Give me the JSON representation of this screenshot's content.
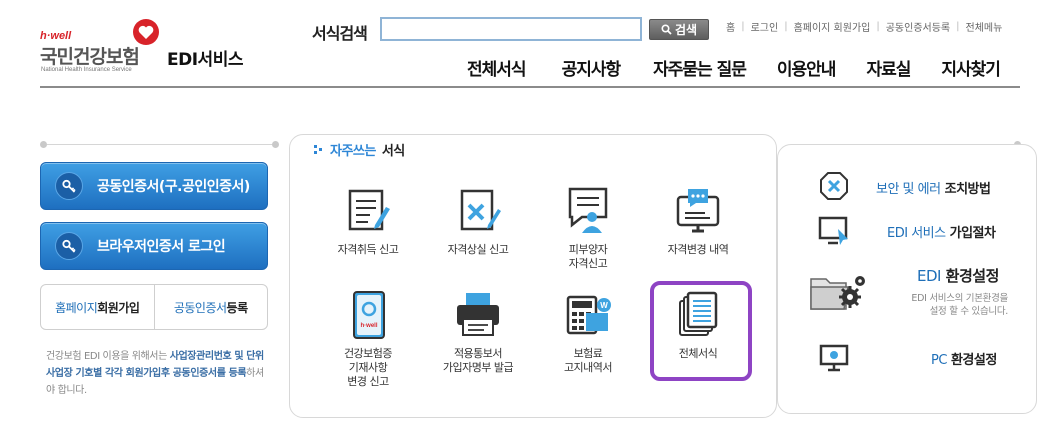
{
  "brand": {
    "hwell": "h·well",
    "name_ko": "국민건강보험",
    "name_en": "National Health Insurance Service",
    "service": "EDI서비스",
    "heart_color": "#d8232a"
  },
  "search": {
    "label": "서식검색",
    "value": "",
    "placeholder": "",
    "button_label": "검색"
  },
  "util_links": [
    "홈",
    "로그인",
    "홈페이지 회원가입",
    "공동인증서등록",
    "전체메뉴"
  ],
  "gnb": [
    "전체서식",
    "공지사항",
    "자주묻는 질문",
    "이용안내",
    "자료실",
    "지사찾기"
  ],
  "left": {
    "cert_button": "공동인증서(구.공인인증서)",
    "browser_button": "브라우저인증서 로그인",
    "link1": {
      "blue": "홈페이지",
      "dark": " 회원가입"
    },
    "link2": {
      "blue": "공동인증서",
      "dark": " 등록"
    },
    "notice": {
      "p1": "건강보험 EDI 이용을 위해서는 ",
      "e1": "사업장관리번호 및 단위 사업장 기호별 각각 회원가입후 공동인증서를 등록",
      "p2": "하셔야 합니다."
    }
  },
  "favorites": {
    "title_blue": "자주쓰는",
    "title_dark": "서식",
    "items": [
      {
        "label": "자격취득 신고",
        "icon": "form-pen-icon"
      },
      {
        "label": "자격상실 신고",
        "icon": "form-x-icon"
      },
      {
        "label": "피부양자\n자격신고",
        "icon": "dependent-person-icon"
      },
      {
        "label": "자격변경 내역",
        "icon": "monitor-chat-icon"
      },
      {
        "label": "건강보험증\n기재사항\n변경 신고",
        "icon": "insurance-card-icon"
      },
      {
        "label": "적용통보서\n가입자명부 발급",
        "icon": "printer-icon"
      },
      {
        "label": "보험료\n고지내역서",
        "icon": "calculator-icon"
      },
      {
        "label": "전체서식",
        "icon": "document-stack-icon"
      }
    ],
    "highlight_color": "#8e44c4"
  },
  "right": {
    "security": {
      "blue": "보안 및 에러",
      "dark": " 조치방법"
    },
    "join": {
      "blue": "EDI 서비스",
      "dark": " 가입절차"
    },
    "env": {
      "blue": "EDI",
      "dark": " 환경설정",
      "desc": "EDI 서비스의 기본환경을\n설정 할 수 있습니다."
    },
    "pc": {
      "blue": "PC",
      "dark": " 환경설정"
    }
  },
  "colors": {
    "primary_blue": "#1f6fb8",
    "button_blue": "#2a84d2",
    "accent_purple": "#8e44c4"
  }
}
